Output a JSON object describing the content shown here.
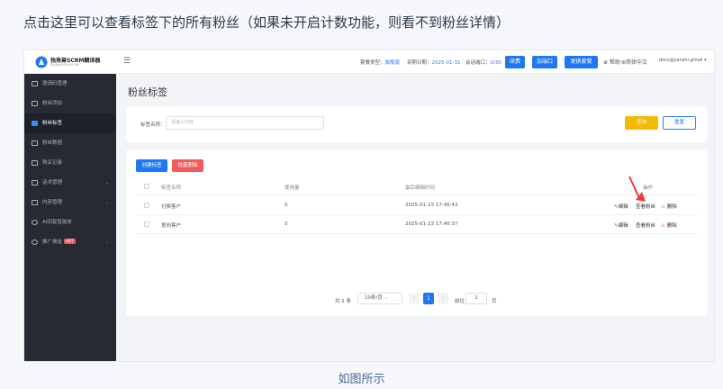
{
  "caption_top": "点击这里可以查看标签下的所有粉丝（如果未开启计数功能，则看不到粉丝详情）",
  "caption_bottom": "如图所示",
  "app": {
    "name": "独角兽SCRM翻译器",
    "sub": "DUJIAOSHOU.IM"
  },
  "topbar": {
    "plan_label": "套餐类型：",
    "plan_value": "旗舰版",
    "expire_label": "到期日期：",
    "expire_value": "2025-01-31",
    "session_label": "会话端口：",
    "session_value": "0/30",
    "renew_btn": "续费",
    "add_port_btn": "加端口",
    "change_plan_btn": "更换套餐",
    "help": "帮助",
    "lang": "简体中文",
    "email": "docs@yanshi.gmail"
  },
  "sidebar": {
    "items": [
      {
        "label": "邀请码管理"
      },
      {
        "label": "粉丝添加"
      },
      {
        "label": "粉丝标签"
      },
      {
        "label": "粉丝数据"
      },
      {
        "label": "购买记录"
      },
      {
        "label": "话术管理"
      },
      {
        "label": "内容管理"
      },
      {
        "label": "AI回复智能体"
      },
      {
        "label": "推广佣金",
        "badge": "HOT"
      }
    ]
  },
  "page_title": "粉丝标签",
  "search": {
    "label": "标签名称：",
    "placeholder": "请输入内容",
    "search_btn": "查询",
    "reset_btn": "重置"
  },
  "toolbar": {
    "create_btn": "创建标签",
    "bulk_delete_btn": "批量删除"
  },
  "table": {
    "headers": [
      "标签名称",
      "使用量",
      "最后编辑时间",
      "操作"
    ],
    "rows": [
      {
        "name": "付费客户",
        "usage": "0",
        "edited": "2025-01-23 17:46:43"
      },
      {
        "name": "意向客户",
        "usage": "0",
        "edited": "2025-01-23 17:46:37"
      }
    ],
    "actions": {
      "edit": "编辑",
      "view_fans": "查看粉丝",
      "delete": "删除"
    }
  },
  "pagination": {
    "total": "共 2 条",
    "page_size": "10条/页",
    "current_page": "1",
    "goto_label": "前往",
    "goto_value": "1",
    "page_suffix": "页"
  },
  "colors": {
    "primary": "#1f77f5",
    "warning": "#f5b900",
    "danger": "#f25b5b",
    "sidebar_bg": "#262b33"
  }
}
